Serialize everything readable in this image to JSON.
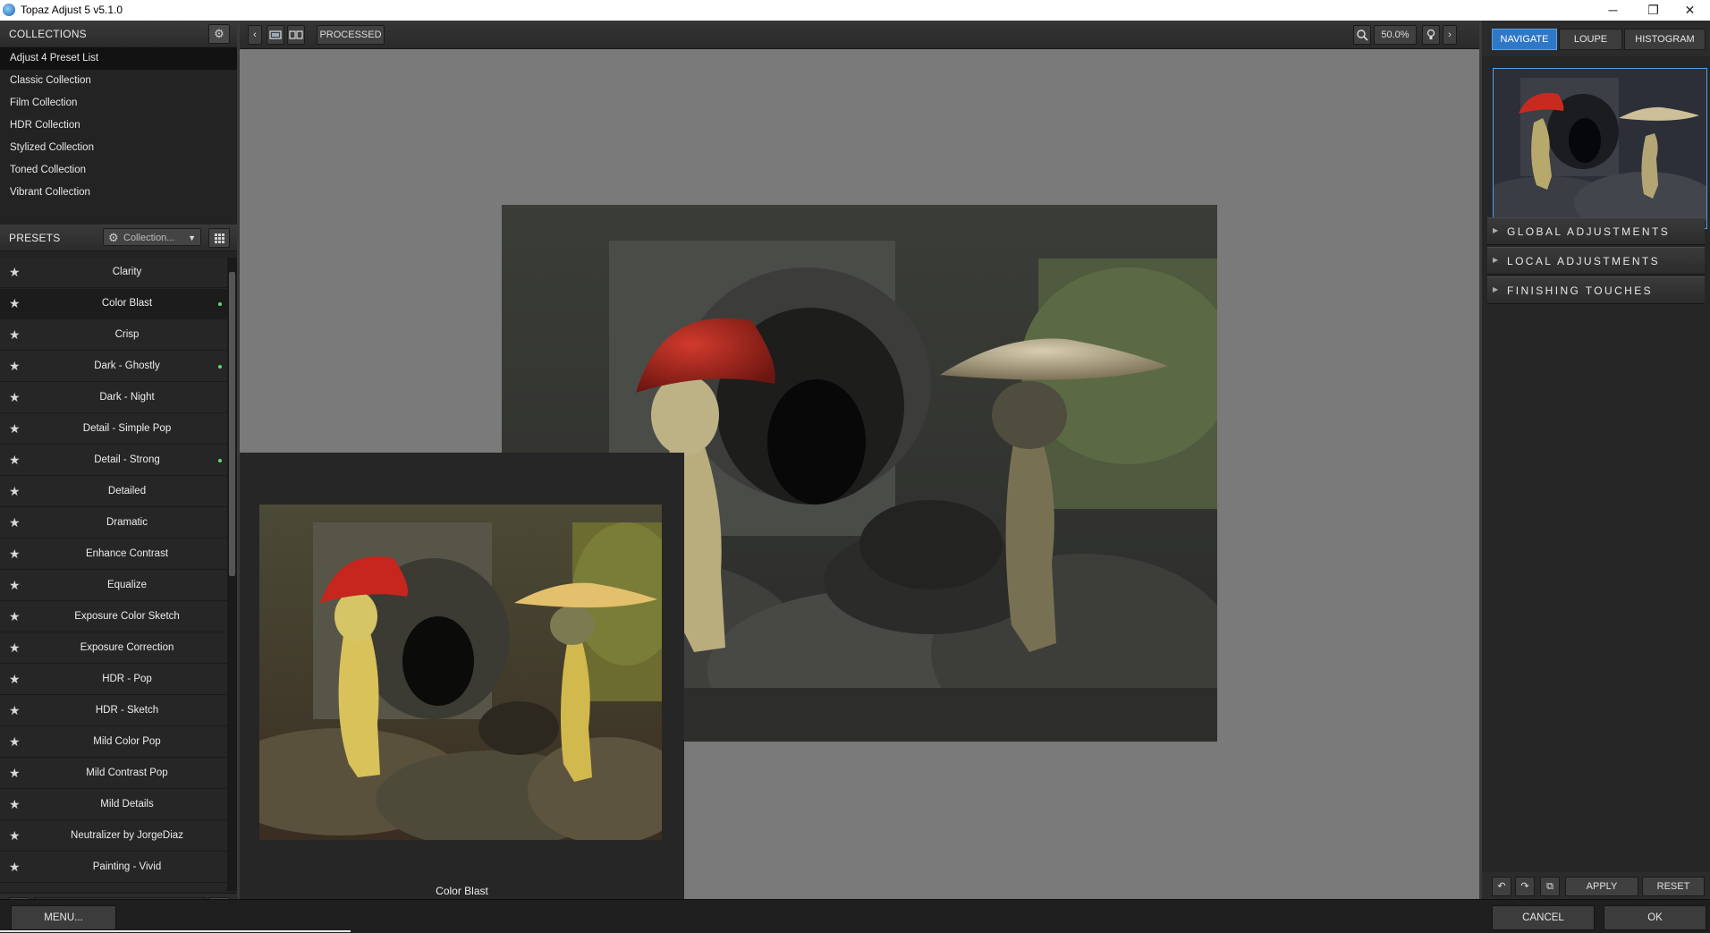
{
  "window": {
    "title": "Topaz Adjust 5 v5.1.0",
    "minimize": "─",
    "restore": "❐",
    "close": "✕"
  },
  "collections": {
    "header": "COLLECTIONS",
    "items": [
      "Adjust 4 Preset List",
      "Classic Collection",
      "Film Collection",
      "HDR Collection",
      "Stylized Collection",
      "Toned Collection",
      "Vibrant Collection"
    ],
    "selected": "Adjust 4 Preset List"
  },
  "presets": {
    "header": "PRESETS",
    "dropdown": "Collection...",
    "items": [
      {
        "name": "Clarity",
        "dot": false
      },
      {
        "name": "Color Blast",
        "dot": true,
        "selected": true
      },
      {
        "name": "Crisp",
        "dot": false
      },
      {
        "name": "Dark - Ghostly",
        "dot": true
      },
      {
        "name": "Dark - Night",
        "dot": false
      },
      {
        "name": "Detail - Simple Pop",
        "dot": false
      },
      {
        "name": "Detail - Strong",
        "dot": true
      },
      {
        "name": "Detailed",
        "dot": false
      },
      {
        "name": "Dramatic",
        "dot": false
      },
      {
        "name": "Enhance Contrast",
        "dot": false
      },
      {
        "name": "Equalize",
        "dot": false
      },
      {
        "name": "Exposure Color Sketch",
        "dot": false
      },
      {
        "name": "Exposure Correction",
        "dot": false
      },
      {
        "name": "HDR - Pop",
        "dot": false
      },
      {
        "name": "HDR - Sketch",
        "dot": false
      },
      {
        "name": "Mild Color Pop",
        "dot": false
      },
      {
        "name": "Mild Contrast Pop",
        "dot": false
      },
      {
        "name": "Mild Details",
        "dot": false
      },
      {
        "name": "Neutralizer by JorgeDiaz",
        "dot": false
      },
      {
        "name": "Painting - Vivid",
        "dot": false
      }
    ]
  },
  "toolbar": {
    "view_mode": "PROCESSED",
    "zoom": "50.0%"
  },
  "preview": {
    "caption": "Color Blast"
  },
  "right": {
    "tabs": [
      "NAVIGATE",
      "LOUPE",
      "HISTOGRAM"
    ],
    "active_tab": "NAVIGATE",
    "sections": [
      "GLOBAL ADJUSTMENTS",
      "LOCAL ADJUSTMENTS",
      "FINISHING TOUCHES"
    ],
    "apply": "APPLY",
    "reset": "RESET"
  },
  "footer": {
    "menu": "MENU...",
    "cancel": "CANCEL",
    "ok": "OK"
  },
  "colors": {
    "accent": "#2f78c7",
    "new_dot": "#5fdc6a",
    "panel": "#232323",
    "canvas": "#7a7a7a"
  }
}
